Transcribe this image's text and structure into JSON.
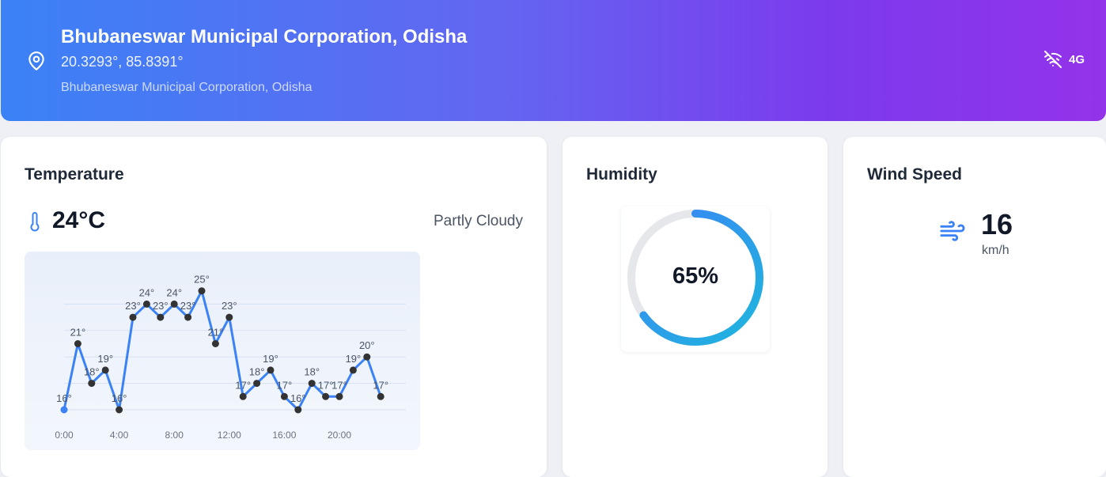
{
  "header": {
    "title": "Bhubaneswar Municipal Corporation, Odisha",
    "coordinates": "20.3293°, 85.8391°",
    "subtitle": "Bhubaneswar Municipal Corporation, Odisha",
    "network_label": "4G",
    "icons": {
      "location": "map-pin-icon",
      "network": "wifi-off-icon"
    }
  },
  "temperature": {
    "heading": "Temperature",
    "value": "24°C",
    "condition": "Partly Cloudy",
    "icon": "thermometer-icon"
  },
  "humidity": {
    "heading": "Humidity",
    "value": "65%"
  },
  "wind": {
    "heading": "Wind Speed",
    "value": "16",
    "unit": "km/h",
    "icon": "wind-icon"
  },
  "colors": {
    "header_start": "#3b82f6",
    "header_end": "#9333ea",
    "accent": "#3b82f6",
    "gauge_light": "#1fb6dd",
    "point": "#333333"
  },
  "chart_data": {
    "type": "line",
    "x_ticks": [
      "0:00",
      "4:00",
      "8:00",
      "12:00",
      "16:00",
      "20:00"
    ],
    "x": [
      0,
      1,
      2,
      3,
      4,
      5,
      6,
      7,
      8,
      9,
      10,
      11,
      12,
      13,
      14,
      15,
      16,
      17,
      18,
      19,
      20,
      21,
      22,
      23
    ],
    "series": [
      {
        "values": [
          16,
          21,
          18,
          19,
          16,
          23,
          24,
          23,
          24,
          23,
          25,
          21,
          23,
          17,
          18,
          19,
          17,
          16,
          18,
          17,
          17,
          19,
          20,
          17
        ]
      }
    ],
    "point_label_suffix": "°",
    "ylim": [
      15,
      26
    ],
    "grid": true
  }
}
